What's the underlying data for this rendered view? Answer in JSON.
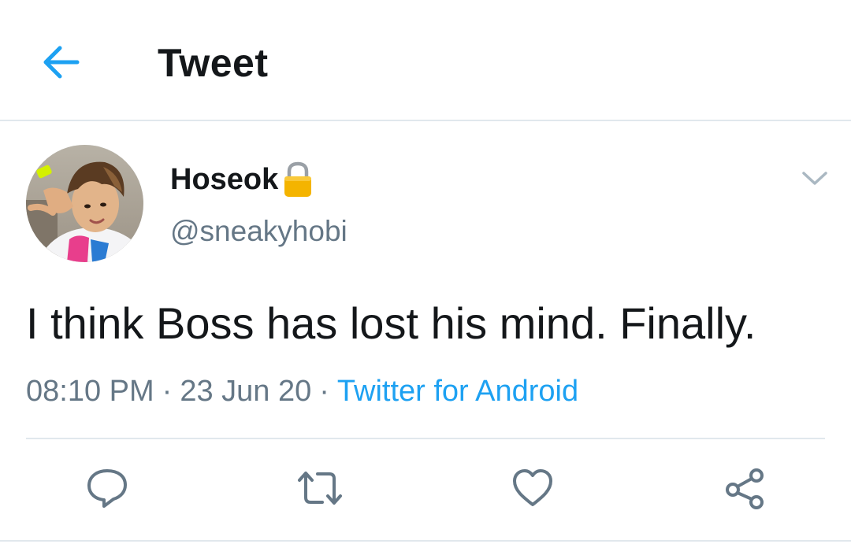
{
  "header": {
    "title": "Tweet",
    "back_icon": "arrow-left-icon"
  },
  "tweet": {
    "author": {
      "display_name": "Hoseok",
      "handle": "@sneakyhobi",
      "protected_icon": "lock-icon",
      "avatar": "profile-photo"
    },
    "text": "I think Boss has lost his mind. Finally.",
    "time": "08:10 PM",
    "date": "23 Jun 20",
    "separator": "·",
    "source": "Twitter for Android",
    "menu_icon": "chevron-down-icon"
  },
  "actions": [
    {
      "name": "reply",
      "icon": "reply-icon"
    },
    {
      "name": "retweet",
      "icon": "retweet-icon"
    },
    {
      "name": "like",
      "icon": "heart-icon"
    },
    {
      "name": "share",
      "icon": "share-icon"
    }
  ],
  "colors": {
    "accent": "#1da1f2",
    "text_primary": "#14171a",
    "text_secondary": "#657786",
    "divider": "#e1e8ed",
    "lock": "#f4b400"
  }
}
